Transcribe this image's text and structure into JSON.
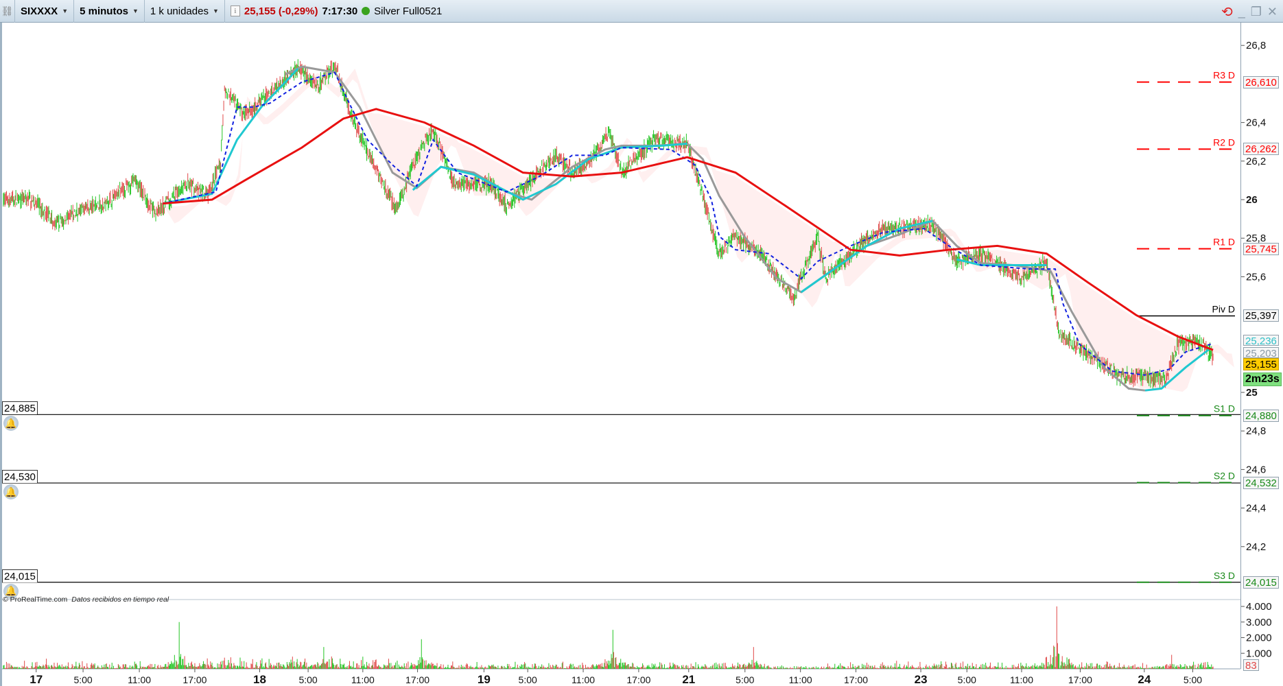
{
  "header": {
    "symbol": "SIXXXX",
    "timeframe": "5 minutos",
    "units": "1 k unidades",
    "price": "25,155 (-0,29%)",
    "time": "7:17:30",
    "instrument": "Silver Full0521"
  },
  "footer": {
    "copyright": "© ProRealTime.com",
    "status": "Datos recibidos en tiempo real"
  },
  "alerts": [
    {
      "label": "24,885",
      "price": 24.885
    },
    {
      "label": "24,530",
      "price": 24.53
    },
    {
      "label": "24,015",
      "price": 24.015
    }
  ],
  "pivots": [
    {
      "name": "R3 D",
      "label": "26,610",
      "price": 26.61,
      "color": "#ff0000",
      "style": "dash"
    },
    {
      "name": "R2 D",
      "label": "26,262",
      "price": 26.262,
      "color": "#ff0000",
      "style": "dash"
    },
    {
      "name": "R1 D",
      "label": "25,745",
      "price": 25.745,
      "color": "#ff0000",
      "style": "dash"
    },
    {
      "name": "Piv D",
      "label": "25,397",
      "price": 25.397,
      "color": "#000000",
      "style": "solid"
    },
    {
      "name": "S1 D",
      "label": "24,880",
      "price": 24.88,
      "color": "#1a8a1a",
      "style": "dash"
    },
    {
      "name": "S2 D",
      "label": "24,532",
      "price": 24.532,
      "color": "#1a8a1a",
      "style": "dash"
    },
    {
      "name": "S3 D",
      "label": "24,015",
      "price": 24.015,
      "color": "#1a8a1a",
      "style": "dash"
    }
  ],
  "tags": {
    "cyan": "25,236",
    "gray": "25,203",
    "last": "25,155",
    "timer": "2m23s",
    "volume": "83"
  },
  "chart_data": {
    "type": "candlestick",
    "price_ticks": [
      "26,8",
      "26,4",
      "26,2",
      "26",
      "25,8",
      "25,6",
      "25",
      "24,8",
      "24,6",
      "24,4",
      "24,2"
    ],
    "price_tick_values": [
      26.8,
      26.4,
      26.2,
      26,
      25.8,
      25.6,
      25,
      24.8,
      24.6,
      24.4,
      24.2
    ],
    "volume_ticks": [
      "4.000",
      "3.000",
      "2.000",
      "1.000"
    ],
    "volume_tick_values": [
      4000,
      3000,
      2000,
      1000
    ],
    "x_labels": [
      {
        "t": "17",
        "bar": 0,
        "bold": true
      },
      {
        "t": "5:00",
        "bar": 60
      },
      {
        "t": "11:00",
        "bar": 132
      },
      {
        "t": "17:00",
        "bar": 203
      },
      {
        "t": "18",
        "bar": 286,
        "bold": true
      },
      {
        "t": "5:00",
        "bar": 348
      },
      {
        "t": "11:00",
        "bar": 418
      },
      {
        "t": "17:00",
        "bar": 488
      },
      {
        "t": "19",
        "bar": 573,
        "bold": true
      },
      {
        "t": "5:00",
        "bar": 629
      },
      {
        "t": "11:00",
        "bar": 700
      },
      {
        "t": "17:00",
        "bar": 771
      },
      {
        "t": "21",
        "bar": 835,
        "bold": true
      },
      {
        "t": "5:00",
        "bar": 907
      },
      {
        "t": "11:00",
        "bar": 978
      },
      {
        "t": "17:00",
        "bar": 1049
      },
      {
        "t": "23",
        "bar": 1132,
        "bold": true
      },
      {
        "t": "5:00",
        "bar": 1191
      },
      {
        "t": "11:00",
        "bar": 1261
      },
      {
        "t": "17:00",
        "bar": 1336
      },
      {
        "t": "24",
        "bar": 1418,
        "bold": true
      },
      {
        "t": "5:00",
        "bar": 1480
      }
    ],
    "price_path": [
      [
        5,
        26.0
      ],
      [
        42,
        26.0
      ],
      [
        73,
        25.87
      ],
      [
        105,
        25.95
      ],
      [
        136,
        25.98
      ],
      [
        173,
        26.1
      ],
      [
        199,
        25.93
      ],
      [
        241,
        26.08
      ],
      [
        267,
        26.02
      ],
      [
        283,
        26.19
      ],
      [
        288,
        26.57
      ],
      [
        314,
        26.44
      ],
      [
        335,
        26.51
      ],
      [
        366,
        26.63
      ],
      [
        382,
        26.68
      ],
      [
        408,
        26.59
      ],
      [
        429,
        26.7
      ],
      [
        450,
        26.44
      ],
      [
        471,
        26.25
      ],
      [
        508,
        25.95
      ],
      [
        534,
        26.23
      ],
      [
        555,
        26.36
      ],
      [
        581,
        26.08
      ],
      [
        628,
        26.08
      ],
      [
        649,
        25.97
      ],
      [
        681,
        26.1
      ],
      [
        712,
        26.23
      ],
      [
        733,
        26.14
      ],
      [
        754,
        26.19
      ],
      [
        780,
        26.36
      ],
      [
        796,
        26.14
      ],
      [
        838,
        26.31
      ],
      [
        880,
        26.29
      ],
      [
        900,
        26.02
      ],
      [
        921,
        25.72
      ],
      [
        942,
        25.81
      ],
      [
        974,
        25.72
      ],
      [
        1016,
        25.49
      ],
      [
        1047,
        25.81
      ],
      [
        1057,
        25.59
      ],
      [
        1099,
        25.76
      ],
      [
        1131,
        25.85
      ],
      [
        1194,
        25.87
      ],
      [
        1225,
        25.68
      ],
      [
        1256,
        25.72
      ],
      [
        1309,
        25.59
      ],
      [
        1340,
        25.68
      ],
      [
        1356,
        25.3
      ],
      [
        1403,
        25.17
      ],
      [
        1434,
        25.08
      ],
      [
        1466,
        25.08
      ],
      [
        1492,
        25.06
      ],
      [
        1508,
        25.25
      ],
      [
        1534,
        25.27
      ],
      [
        1553,
        25.19
      ]
    ],
    "ma_red": [
      [
        209,
        25.98
      ],
      [
        272,
        26.0
      ],
      [
        314,
        26.1
      ],
      [
        387,
        26.27
      ],
      [
        440,
        26.42
      ],
      [
        482,
        26.47
      ],
      [
        544,
        26.4
      ],
      [
        607,
        26.28
      ],
      [
        670,
        26.14
      ],
      [
        733,
        26.12
      ],
      [
        796,
        26.14
      ],
      [
        880,
        26.22
      ],
      [
        942,
        26.14
      ],
      [
        1005,
        25.97
      ],
      [
        1089,
        25.74
      ],
      [
        1152,
        25.71
      ],
      [
        1215,
        25.74
      ],
      [
        1277,
        25.76
      ],
      [
        1340,
        25.72
      ],
      [
        1393,
        25.57
      ],
      [
        1455,
        25.4
      ],
      [
        1508,
        25.29
      ],
      [
        1553,
        25.22
      ]
    ],
    "line_gray": [
      [
        366,
        26.65
      ],
      [
        387,
        26.69
      ],
      [
        429,
        26.66
      ],
      [
        461,
        26.48
      ],
      [
        503,
        26.14
      ],
      [
        534,
        26.06
      ],
      [
        565,
        26.17
      ],
      [
        607,
        26.14
      ],
      [
        649,
        26.04
      ],
      [
        681,
        26.0
      ],
      [
        733,
        26.17
      ],
      [
        775,
        26.26
      ],
      [
        796,
        26.28
      ],
      [
        838,
        26.28
      ],
      [
        880,
        26.29
      ],
      [
        900,
        26.21
      ],
      [
        921,
        26.02
      ],
      [
        953,
        25.81
      ],
      [
        995,
        25.59
      ],
      [
        1026,
        25.52
      ],
      [
        1068,
        25.64
      ],
      [
        1110,
        25.76
      ],
      [
        1152,
        25.82
      ],
      [
        1194,
        25.89
      ],
      [
        1225,
        25.76
      ],
      [
        1256,
        25.67
      ],
      [
        1298,
        25.66
      ],
      [
        1345,
        25.63
      ],
      [
        1372,
        25.42
      ],
      [
        1413,
        25.13
      ],
      [
        1445,
        25.02
      ],
      [
        1466,
        25.01
      ]
    ],
    "line_cyan": [
      [
        [
          209,
          25.98
        ],
        [
          272,
          26.03
        ],
        [
          304,
          26.31
        ],
        [
          335,
          26.48
        ],
        [
          366,
          26.61
        ],
        [
          382,
          26.68
        ]
      ],
      [
        [
          529,
          26.05
        ],
        [
          565,
          26.17
        ],
        [
          607,
          26.13
        ],
        [
          670,
          26.0
        ],
        [
          712,
          26.08
        ],
        [
          754,
          26.21
        ],
        [
          796,
          26.27
        ],
        [
          848,
          26.28
        ],
        [
          880,
          26.29
        ]
      ],
      [
        [
          1026,
          25.52
        ],
        [
          1068,
          25.64
        ],
        [
          1110,
          25.76
        ],
        [
          1152,
          25.85
        ],
        [
          1194,
          25.89
        ]
      ],
      [
        [
          1225,
          25.69
        ],
        [
          1256,
          25.66
        ],
        [
          1340,
          25.66
        ]
      ],
      [
        [
          1466,
          25.01
        ],
        [
          1487,
          25.02
        ],
        [
          1518,
          25.13
        ],
        [
          1550,
          25.23
        ]
      ]
    ],
    "line_blue_dashed": [
      [
        209,
        25.98
      ],
      [
        277,
        26.04
      ],
      [
        304,
        26.48
      ],
      [
        325,
        26.48
      ],
      [
        346,
        26.5
      ],
      [
        387,
        26.61
      ],
      [
        429,
        26.66
      ],
      [
        450,
        26.48
      ],
      [
        471,
        26.31
      ],
      [
        503,
        26.18
      ],
      [
        534,
        26.07
      ],
      [
        555,
        26.31
      ],
      [
        586,
        26.14
      ],
      [
        649,
        26.04
      ],
      [
        691,
        26.12
      ],
      [
        733,
        26.23
      ],
      [
        775,
        26.23
      ],
      [
        796,
        26.27
      ],
      [
        859,
        26.26
      ],
      [
        890,
        26.18
      ],
      [
        911,
        26.0
      ],
      [
        921,
        25.81
      ],
      [
        942,
        25.74
      ],
      [
        984,
        25.72
      ],
      [
        1026,
        25.59
      ],
      [
        1047,
        25.68
      ],
      [
        1089,
        25.76
      ],
      [
        1131,
        25.83
      ],
      [
        1183,
        25.85
      ],
      [
        1215,
        25.76
      ],
      [
        1256,
        25.66
      ],
      [
        1319,
        25.64
      ],
      [
        1351,
        25.64
      ],
      [
        1361,
        25.46
      ],
      [
        1382,
        25.25
      ],
      [
        1424,
        25.11
      ],
      [
        1466,
        25.09
      ],
      [
        1497,
        25.12
      ],
      [
        1518,
        25.21
      ],
      [
        1550,
        25.25
      ]
    ],
    "volume_spikes": [
      [
        60,
        650
      ],
      [
        230,
        3000
      ],
      [
        415,
        1400
      ],
      [
        540,
        1900
      ],
      [
        785,
        2500
      ],
      [
        965,
        1400
      ],
      [
        1353,
        4000
      ],
      [
        1500,
        900
      ]
    ],
    "colors": {
      "up": "#22c422",
      "down": "#e04848",
      "ma": "#e81010",
      "gray": "#999999",
      "cyan": "#20c8d0",
      "blue": "#1020e0"
    }
  }
}
